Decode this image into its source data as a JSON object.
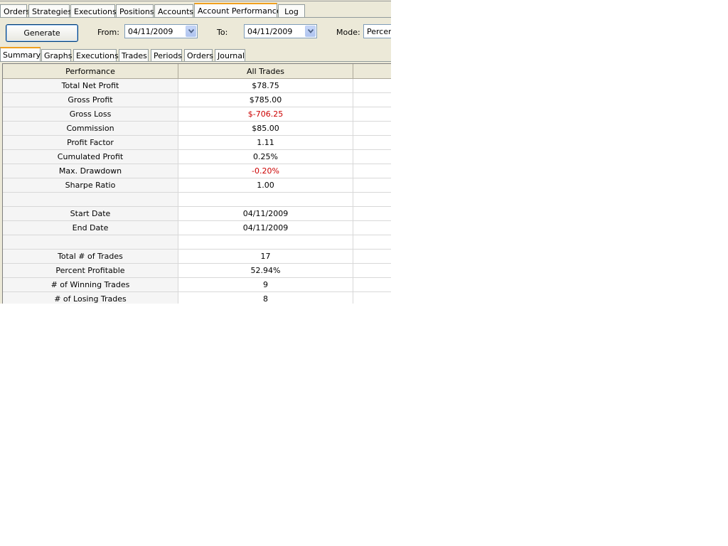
{
  "main_tabs": [
    "Orders",
    "Strategies",
    "Executions",
    "Positions",
    "Accounts",
    "Account Performance",
    "Log"
  ],
  "toolbar": {
    "generate_label": "Generate",
    "from_label": "From:",
    "from_value": "04/11/2009",
    "to_label": "To:",
    "to_value": "04/11/2009",
    "mode_label": "Mode:",
    "mode_value": "Percen"
  },
  "sub_tabs": [
    "Summary",
    "Graphs",
    "Executions",
    "Trades",
    "Periods",
    "Orders",
    "Journal"
  ],
  "table": {
    "columns": [
      "Performance",
      "All Trades",
      ""
    ],
    "rows": [
      {
        "label": "Total Net Profit",
        "value": "$78.75",
        "negative": false
      },
      {
        "label": "Gross Profit",
        "value": "$785.00",
        "negative": false
      },
      {
        "label": "Gross Loss",
        "value": "$-706.25",
        "negative": true
      },
      {
        "label": "Commission",
        "value": "$85.00",
        "negative": false
      },
      {
        "label": "Profit Factor",
        "value": "1.11",
        "negative": false
      },
      {
        "label": "Cumulated Profit",
        "value": "0.25%",
        "negative": false
      },
      {
        "label": "Max. Drawdown",
        "value": "-0.20%",
        "negative": true
      },
      {
        "label": "Sharpe Ratio",
        "value": "1.00",
        "negative": false
      },
      {
        "label": "",
        "value": "",
        "negative": false
      },
      {
        "label": "Start Date",
        "value": "04/11/2009",
        "negative": false
      },
      {
        "label": "End Date",
        "value": "04/11/2009",
        "negative": false
      },
      {
        "label": "",
        "value": "",
        "negative": false
      },
      {
        "label": "Total # of Trades",
        "value": "17",
        "negative": false
      },
      {
        "label": "Percent Profitable",
        "value": "52.94%",
        "negative": false
      },
      {
        "label": "# of Winning Trades",
        "value": "9",
        "negative": false
      },
      {
        "label": "# of Losing Trades",
        "value": "8",
        "negative": false
      }
    ]
  },
  "colors": {
    "negative": "#cc0000",
    "active_tab_accent": "#f0a020"
  }
}
